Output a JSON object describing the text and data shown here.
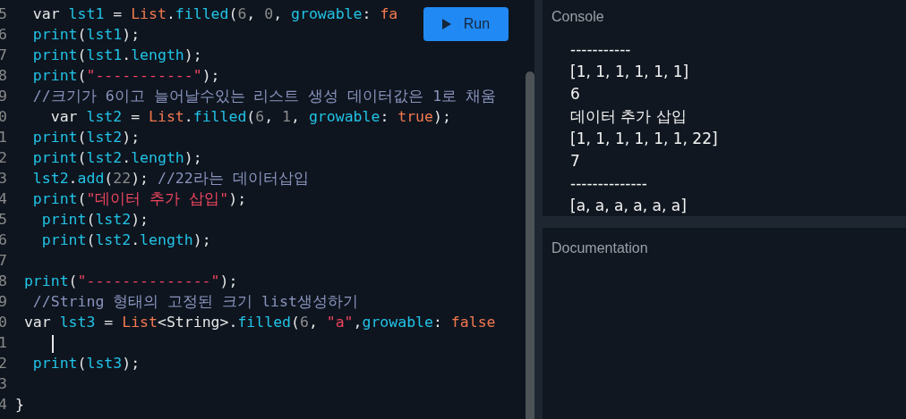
{
  "editor": {
    "lines": [
      {
        "number": "5",
        "tokens": [
          {
            "kind": "keyword",
            "text": "  var"
          },
          {
            "kind": "ident",
            "text": " lst1"
          },
          {
            "kind": "plain",
            "text": " = "
          },
          {
            "kind": "class",
            "text": "List"
          },
          {
            "kind": "plain",
            "text": "."
          },
          {
            "kind": "ident",
            "text": "filled"
          },
          {
            "kind": "plain",
            "text": "("
          },
          {
            "kind": "number",
            "text": "6"
          },
          {
            "kind": "plain",
            "text": ", "
          },
          {
            "kind": "number",
            "text": "0"
          },
          {
            "kind": "plain",
            "text": ", "
          },
          {
            "kind": "ident",
            "text": "growable"
          },
          {
            "kind": "plain",
            "text": ": "
          },
          {
            "kind": "class",
            "text": "fa"
          }
        ]
      },
      {
        "number": "6",
        "tokens": [
          {
            "kind": "ident",
            "text": "  print"
          },
          {
            "kind": "plain",
            "text": "("
          },
          {
            "kind": "ident",
            "text": "lst1"
          },
          {
            "kind": "plain",
            "text": ");"
          }
        ]
      },
      {
        "number": "7",
        "tokens": [
          {
            "kind": "ident",
            "text": "  print"
          },
          {
            "kind": "plain",
            "text": "("
          },
          {
            "kind": "ident",
            "text": "lst1"
          },
          {
            "kind": "plain",
            "text": "."
          },
          {
            "kind": "ident",
            "text": "length"
          },
          {
            "kind": "plain",
            "text": ");"
          }
        ]
      },
      {
        "number": "8",
        "tokens": [
          {
            "kind": "ident",
            "text": "  print"
          },
          {
            "kind": "plain",
            "text": "("
          },
          {
            "kind": "string",
            "text": "\"-----------\""
          },
          {
            "kind": "plain",
            "text": ");"
          }
        ]
      },
      {
        "number": "9",
        "tokens": [
          {
            "kind": "comment",
            "text": "  //크기가 6이고 늘어날수있는 리스트 생성 데이터값은 1로 채움"
          }
        ]
      },
      {
        "number": "0",
        "tokens": [
          {
            "kind": "keyword",
            "text": "    var"
          },
          {
            "kind": "ident",
            "text": " lst2"
          },
          {
            "kind": "plain",
            "text": " = "
          },
          {
            "kind": "class",
            "text": "List"
          },
          {
            "kind": "plain",
            "text": "."
          },
          {
            "kind": "ident",
            "text": "filled"
          },
          {
            "kind": "plain",
            "text": "("
          },
          {
            "kind": "number",
            "text": "6"
          },
          {
            "kind": "plain",
            "text": ", "
          },
          {
            "kind": "number",
            "text": "1"
          },
          {
            "kind": "plain",
            "text": ", "
          },
          {
            "kind": "ident",
            "text": "growable"
          },
          {
            "kind": "plain",
            "text": ": "
          },
          {
            "kind": "class",
            "text": "true"
          },
          {
            "kind": "plain",
            "text": ");"
          }
        ]
      },
      {
        "number": "1",
        "tokens": [
          {
            "kind": "ident",
            "text": "  print"
          },
          {
            "kind": "plain",
            "text": "("
          },
          {
            "kind": "ident",
            "text": "lst2"
          },
          {
            "kind": "plain",
            "text": ");"
          }
        ]
      },
      {
        "number": "2",
        "tokens": [
          {
            "kind": "ident",
            "text": "  print"
          },
          {
            "kind": "plain",
            "text": "("
          },
          {
            "kind": "ident",
            "text": "lst2"
          },
          {
            "kind": "plain",
            "text": "."
          },
          {
            "kind": "ident",
            "text": "length"
          },
          {
            "kind": "plain",
            "text": ");"
          }
        ]
      },
      {
        "number": "3",
        "tokens": [
          {
            "kind": "ident",
            "text": "  lst2"
          },
          {
            "kind": "plain",
            "text": "."
          },
          {
            "kind": "ident",
            "text": "add"
          },
          {
            "kind": "plain",
            "text": "("
          },
          {
            "kind": "number",
            "text": "22"
          },
          {
            "kind": "plain",
            "text": "); "
          },
          {
            "kind": "comment",
            "text": "//22라는 데이터삽입"
          }
        ]
      },
      {
        "number": "4",
        "tokens": [
          {
            "kind": "ident",
            "text": "  print"
          },
          {
            "kind": "plain",
            "text": "("
          },
          {
            "kind": "string",
            "text": "\"데이터 추가 삽입\""
          },
          {
            "kind": "plain",
            "text": ");"
          }
        ]
      },
      {
        "number": "5",
        "tokens": [
          {
            "kind": "ident",
            "text": "   print"
          },
          {
            "kind": "plain",
            "text": "("
          },
          {
            "kind": "ident",
            "text": "lst2"
          },
          {
            "kind": "plain",
            "text": ");"
          }
        ]
      },
      {
        "number": "6",
        "tokens": [
          {
            "kind": "ident",
            "text": "   print"
          },
          {
            "kind": "plain",
            "text": "("
          },
          {
            "kind": "ident",
            "text": "lst2"
          },
          {
            "kind": "plain",
            "text": "."
          },
          {
            "kind": "ident",
            "text": "length"
          },
          {
            "kind": "plain",
            "text": ");"
          }
        ]
      },
      {
        "number": "7"
      },
      {
        "number": "8",
        "tokens": [
          {
            "kind": "ident",
            "text": " print"
          },
          {
            "kind": "plain",
            "text": "("
          },
          {
            "kind": "string",
            "text": "\"--------------\""
          },
          {
            "kind": "plain",
            "text": ");"
          }
        ]
      },
      {
        "number": "9",
        "tokens": [
          {
            "kind": "comment",
            "text": "  //String 형태의 고정된 크기 list생성하기"
          }
        ]
      },
      {
        "number": "0",
        "tokens": [
          {
            "kind": "keyword",
            "text": " var"
          },
          {
            "kind": "ident",
            "text": " lst3"
          },
          {
            "kind": "plain",
            "text": " = "
          },
          {
            "kind": "class",
            "text": "List"
          },
          {
            "kind": "plain",
            "text": "<String>."
          },
          {
            "kind": "ident",
            "text": "filled"
          },
          {
            "kind": "plain",
            "text": "("
          },
          {
            "kind": "number",
            "text": "6"
          },
          {
            "kind": "plain",
            "text": ", "
          },
          {
            "kind": "string",
            "text": "\"a\""
          },
          {
            "kind": "plain",
            "text": ","
          },
          {
            "kind": "ident",
            "text": "growable"
          },
          {
            "kind": "plain",
            "text": ": "
          },
          {
            "kind": "class",
            "text": "false"
          }
        ]
      },
      {
        "number": "1",
        "cursor": true
      },
      {
        "number": "2",
        "tokens": [
          {
            "kind": "ident",
            "text": "  print"
          },
          {
            "kind": "plain",
            "text": "("
          },
          {
            "kind": "ident",
            "text": "lst3"
          },
          {
            "kind": "plain",
            "text": ");"
          }
        ]
      },
      {
        "number": "3"
      },
      {
        "number": "4",
        "tokens": [
          {
            "kind": "plain",
            "text": "}"
          }
        ]
      }
    ]
  },
  "run_button": {
    "label": "Run"
  },
  "console": {
    "title": "Console",
    "output": [
      "-----------",
      "[1, 1, 1, 1, 1, 1]",
      "6",
      "데이터 추가 삽입",
      "[1, 1, 1, 1, 1, 1, 22]",
      "7",
      "--------------",
      "[a, a, a, a, a, a]"
    ]
  },
  "documentation": {
    "title": "Documentation"
  }
}
